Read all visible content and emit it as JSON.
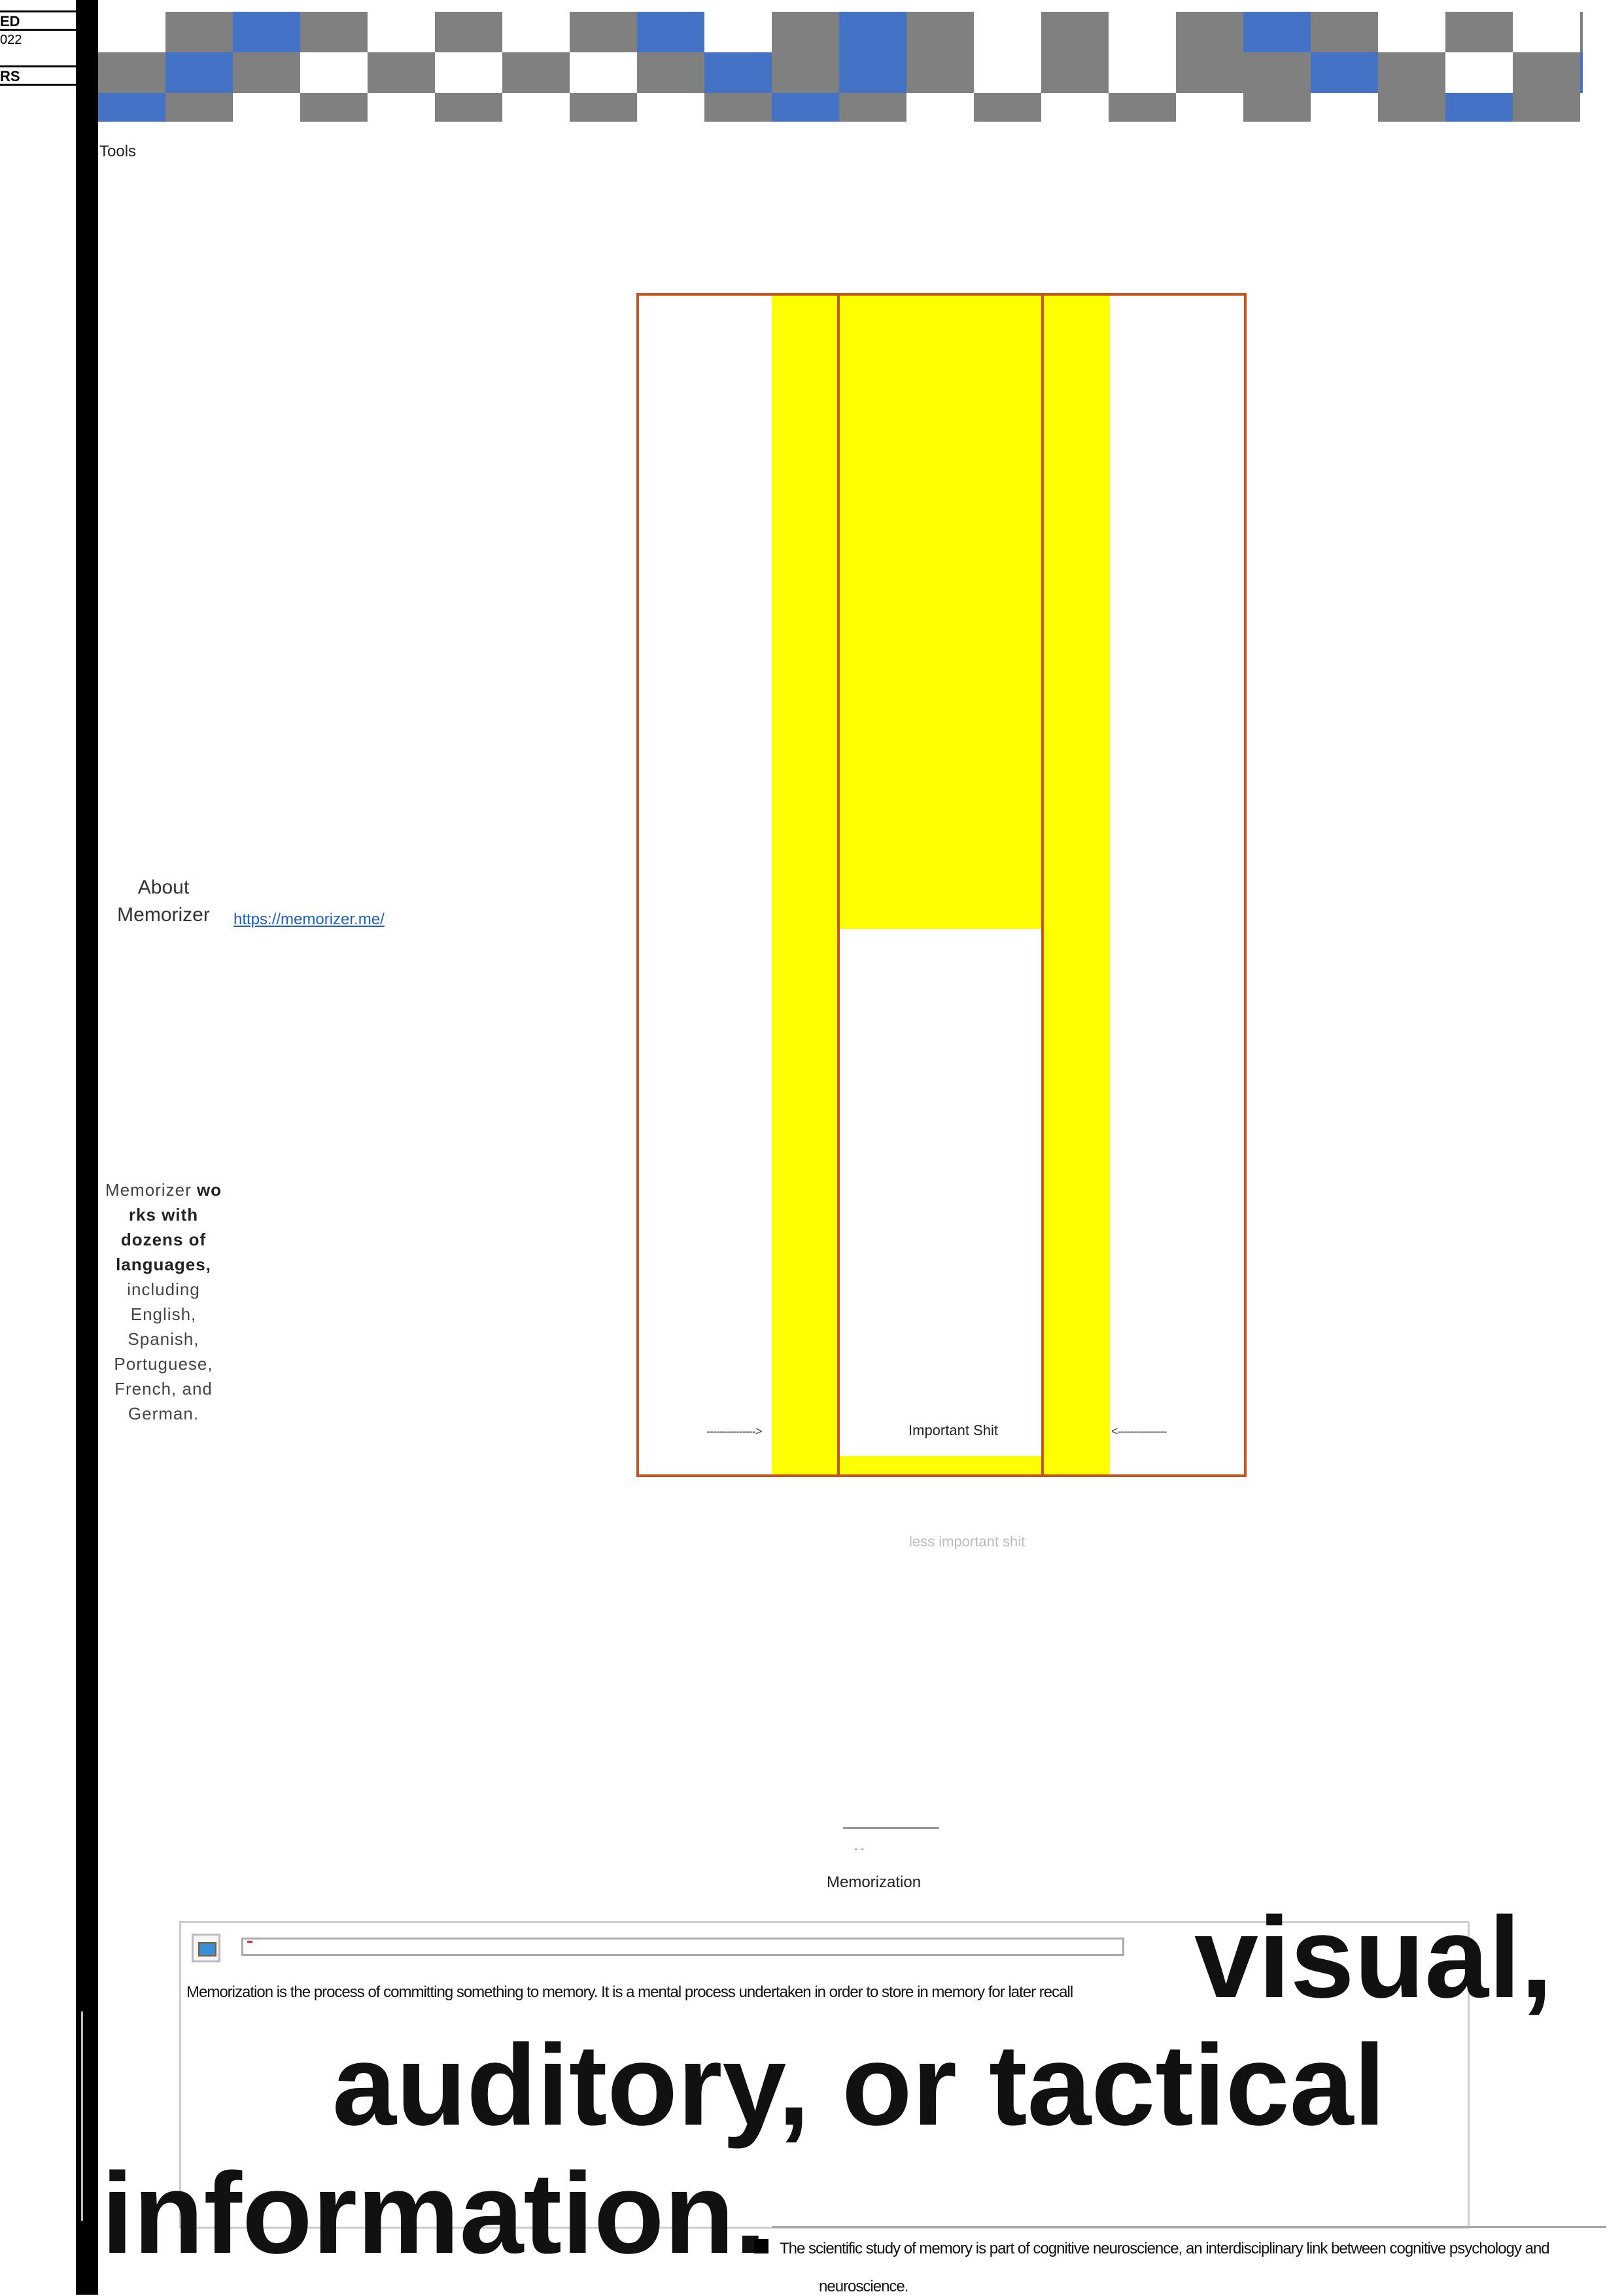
{
  "margin_stubs": [
    "ED",
    "022",
    "RS"
  ],
  "header_checker": {
    "colors": {
      "gray": "#808080",
      "blue": "#4472c4",
      "white": "#ffffff"
    },
    "rows": [
      "WWWWWWWWWWWWWWWWWWWWWWWW",
      "WGBGWGWGBWGBGWGWGBGWGWGB",
      "GBGWGWGWGBGBGWGWGGBGWGBW",
      "BGWGWGWGWGBGWGWGWGWGBGWW"
    ]
  },
  "tools_label": "Tools",
  "about": {
    "line1": "About",
    "line2": "Memorizer",
    "link_text": "https://memorizer.me/"
  },
  "works": {
    "lines": [
      {
        "text": "Memorizer ",
        "bold": "wo"
      },
      {
        "text": "",
        "bold": "rks with"
      },
      {
        "text": "",
        "bold": "dozens of"
      },
      {
        "text": "",
        "bold": "languages,"
      },
      {
        "text": "including",
        "bold": ""
      },
      {
        "text": "English,",
        "bold": ""
      },
      {
        "text": "Spanish,",
        "bold": ""
      },
      {
        "text": "Portuguese,",
        "bold": ""
      },
      {
        "text": "French, and",
        "bold": ""
      },
      {
        "text": "German.",
        "bold": ""
      }
    ]
  },
  "diagram": {
    "center_label": "Important Shit",
    "left_arrow": "--------------->",
    "right_arrow": "<---------------",
    "below_label": "less important shit",
    "colors": {
      "highlight": "#ffff00",
      "border": "#c8561c"
    }
  },
  "memorization": {
    "title": "Memorization",
    "red_mark": "- -",
    "panel_text": "Memorization is the process of committing something to memory. It is a mental process undertaken in order to store in memory for later recall",
    "big_line1": "visual,",
    "big_line2": "auditory, or tactical",
    "big_line3": "information.",
    "bottom_text": "The scientific study of memory is part of cognitive neuroscience, an interdisciplinary link between cognitive psychology and",
    "bottom_text2": "neuroscience."
  }
}
